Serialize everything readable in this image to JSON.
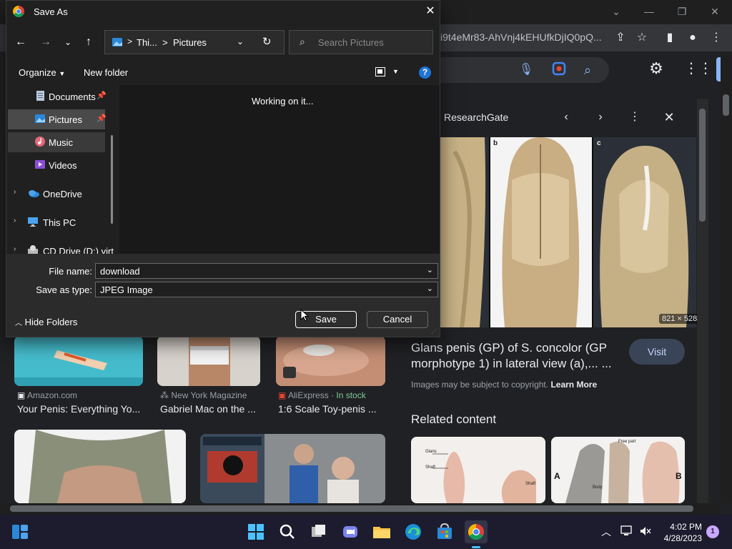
{
  "dialog": {
    "title": "Save As",
    "address": {
      "segment1": "Thi...",
      "separator": ">",
      "segment2": "Pictures"
    },
    "search_placeholder": "Search Pictures",
    "commands": {
      "organize": "Organize",
      "new_folder": "New folder"
    },
    "nav_items": [
      {
        "label": "Documents",
        "icon": "documents-icon"
      },
      {
        "label": "Pictures",
        "icon": "pictures-icon"
      },
      {
        "label": "Music",
        "icon": "music-icon"
      },
      {
        "label": "Videos",
        "icon": "videos-icon"
      },
      {
        "label": "OneDrive",
        "icon": "onedrive-icon"
      },
      {
        "label": "This PC",
        "icon": "this-pc-icon"
      },
      {
        "label": "CD Drive (D:) virt",
        "icon": "cd-drive-icon"
      }
    ],
    "content_status": "Working on it...",
    "file_name_label": "File name:",
    "file_name_value": "download",
    "save_type_label": "Save as type:",
    "save_type_value": "JPEG Image",
    "hide_folders": "Hide Folders",
    "save": "Save",
    "cancel": "Cancel"
  },
  "browser": {
    "url_fragment": "i9t4eMr83-AhVnj4kEHUfkDjIQ0pQ...",
    "results": [
      {
        "source": "Amazon.com",
        "title": "Your Penis: Everything Yo..."
      },
      {
        "source": "New York Magazine",
        "title": "Gabriel Mac on the ..."
      },
      {
        "source": "AliExpress",
        "source_extra": " · In stock",
        "title": "1:6 Scale Toy-penis ..."
      }
    ],
    "panel": {
      "source": "ResearchGate",
      "image_dims": "821 × 528",
      "title": "Glans penis (GP) of S. concolor (GP morphotype 1) in lateral view (a),... ...",
      "visit": "Visit",
      "copyright": "Images may be subject to copyright.",
      "learn_more": "Learn More",
      "related": "Related content",
      "preview_labels": {
        "b": "b",
        "c": "c"
      },
      "related_labels": {
        "glans": "Glans",
        "shaft": "Shaft",
        "shaft2": "Shaft",
        "a": "A",
        "b": "B",
        "body": "Body",
        "free_part": "Free part"
      }
    }
  },
  "taskbar": {
    "time": "4:02 PM",
    "date": "4/28/2023",
    "notification_count": "1"
  },
  "colors": {
    "dialog_bg": "#202020",
    "accent": "#0078d4",
    "chrome_bg": "#202124",
    "taskbar_bg": "#1c1c2e"
  }
}
